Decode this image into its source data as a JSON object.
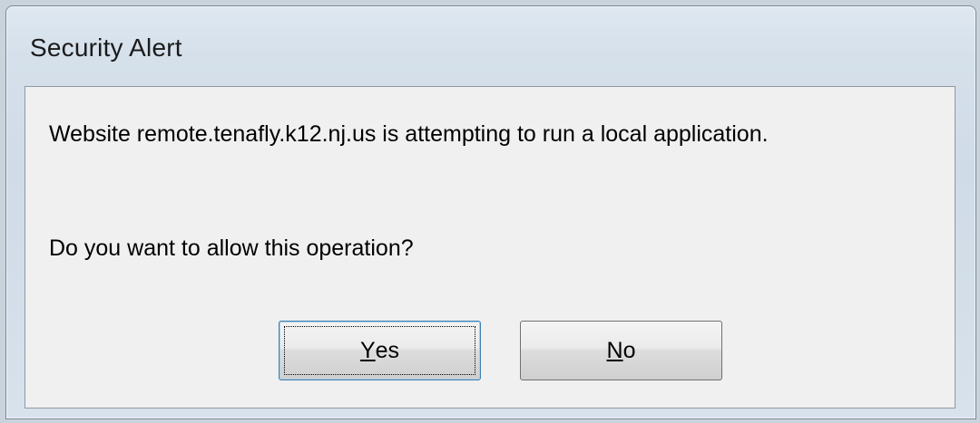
{
  "dialog": {
    "title": "Security Alert",
    "message": "Website remote.tenafly.k12.nj.us is attempting to run a local application.",
    "question": "Do you want to allow this operation?",
    "buttons": {
      "yes": {
        "mnemonic": "Y",
        "rest": "es"
      },
      "no": {
        "mnemonic": "N",
        "rest": "o"
      }
    }
  }
}
